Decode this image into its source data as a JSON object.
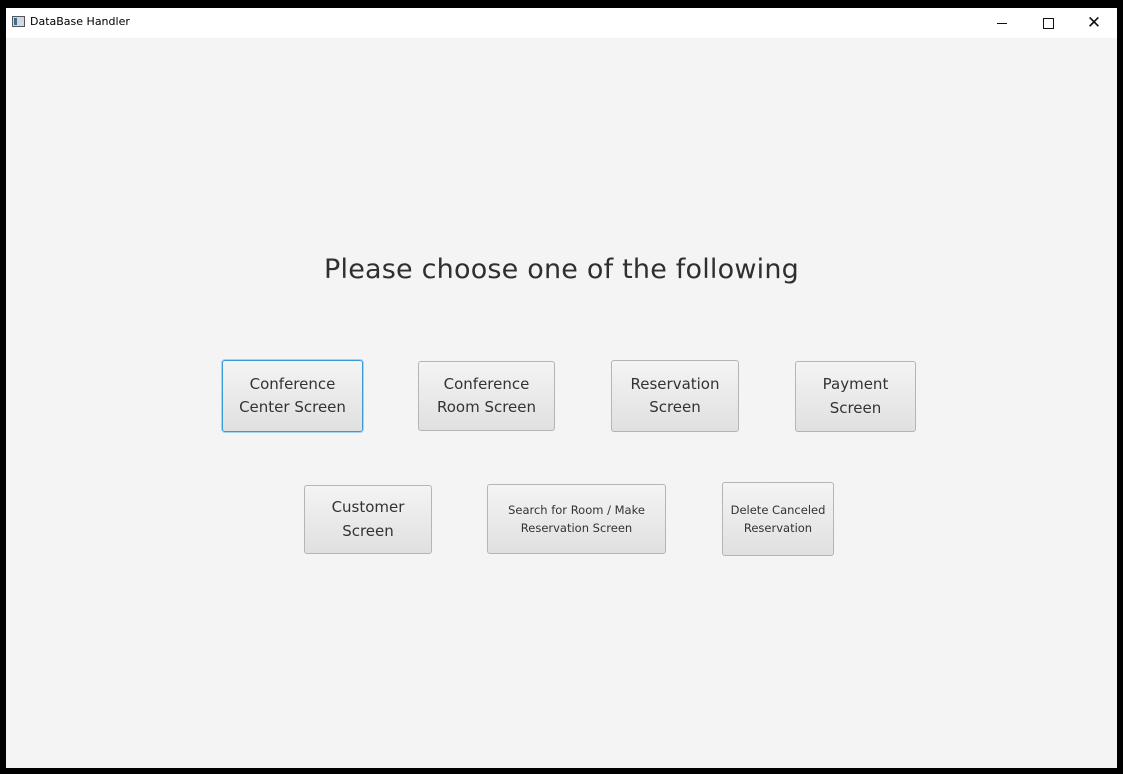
{
  "window": {
    "title": "DataBase Handler",
    "controls": {
      "minimize": "–",
      "maximize": "☐",
      "close": "✕"
    }
  },
  "main": {
    "heading": "Please choose one of the following",
    "buttons": {
      "conference_center": "Conference\nCenter Screen",
      "conference_room": "Conference\nRoom Screen",
      "reservation": "Reservation\nScreen",
      "payment": "Payment\nScreen",
      "customer": "Customer\nScreen",
      "search_room": "Search for Room / Make\nReservation Screen",
      "delete_canceled": "Delete Canceled\nReservation"
    }
  },
  "colors": {
    "focus_border": "#3a9ad9",
    "window_bg": "#f4f4f4",
    "button_border": "#b5b5b5"
  }
}
